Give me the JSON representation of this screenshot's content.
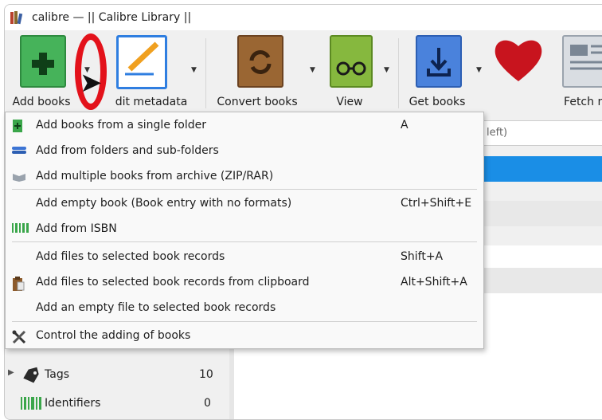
{
  "window": {
    "title": "calibre — || Calibre Library ||"
  },
  "toolbar": {
    "items": [
      {
        "label": "Add books",
        "color": "#3aa64a"
      },
      {
        "label": "Edit metadata",
        "color": "#2f7ee0"
      },
      {
        "label": "Convert books",
        "color": "#8c5a2b"
      },
      {
        "label": "View",
        "color": "#7fae3a"
      },
      {
        "label": "Get books",
        "color": "#3c74d4"
      },
      {
        "label": "Fetch ne"
      }
    ],
    "edit_metadata_visible": "dit metadata"
  },
  "search": {
    "text": "left)"
  },
  "add_menu": {
    "items": [
      {
        "label": "Add books from a single folder",
        "shortcut": "A",
        "icon": "green-book-plus-icon"
      },
      {
        "label": "Add from folders and sub-folders",
        "shortcut": "",
        "icon": "blue-stack-icon"
      },
      {
        "label": "Add multiple books from archive (ZIP/RAR)",
        "shortcut": "",
        "icon": "archive-icon"
      },
      {
        "label": "Add empty book (Book entry with no formats)",
        "shortcut": "Ctrl+Shift+E",
        "icon": ""
      },
      {
        "label": "Add from ISBN",
        "shortcut": "",
        "icon": "barcode-icon"
      },
      {
        "label": "Add files to selected book records",
        "shortcut": "Shift+A",
        "icon": ""
      },
      {
        "label": "Add files to selected book records from clipboard",
        "shortcut": "Alt+Shift+A",
        "icon": "clipboard-icon"
      },
      {
        "label": "Add an empty file to selected book records",
        "shortcut": "",
        "icon": ""
      },
      {
        "label": "Control the adding of books",
        "shortcut": "",
        "icon": "tools-icon"
      }
    ]
  },
  "tag_browser": {
    "items": [
      {
        "label": "Tags",
        "count": "10",
        "icon": "tag-icon"
      },
      {
        "label": "Identifiers",
        "count": "0",
        "icon": "barcode-icon"
      }
    ]
  }
}
